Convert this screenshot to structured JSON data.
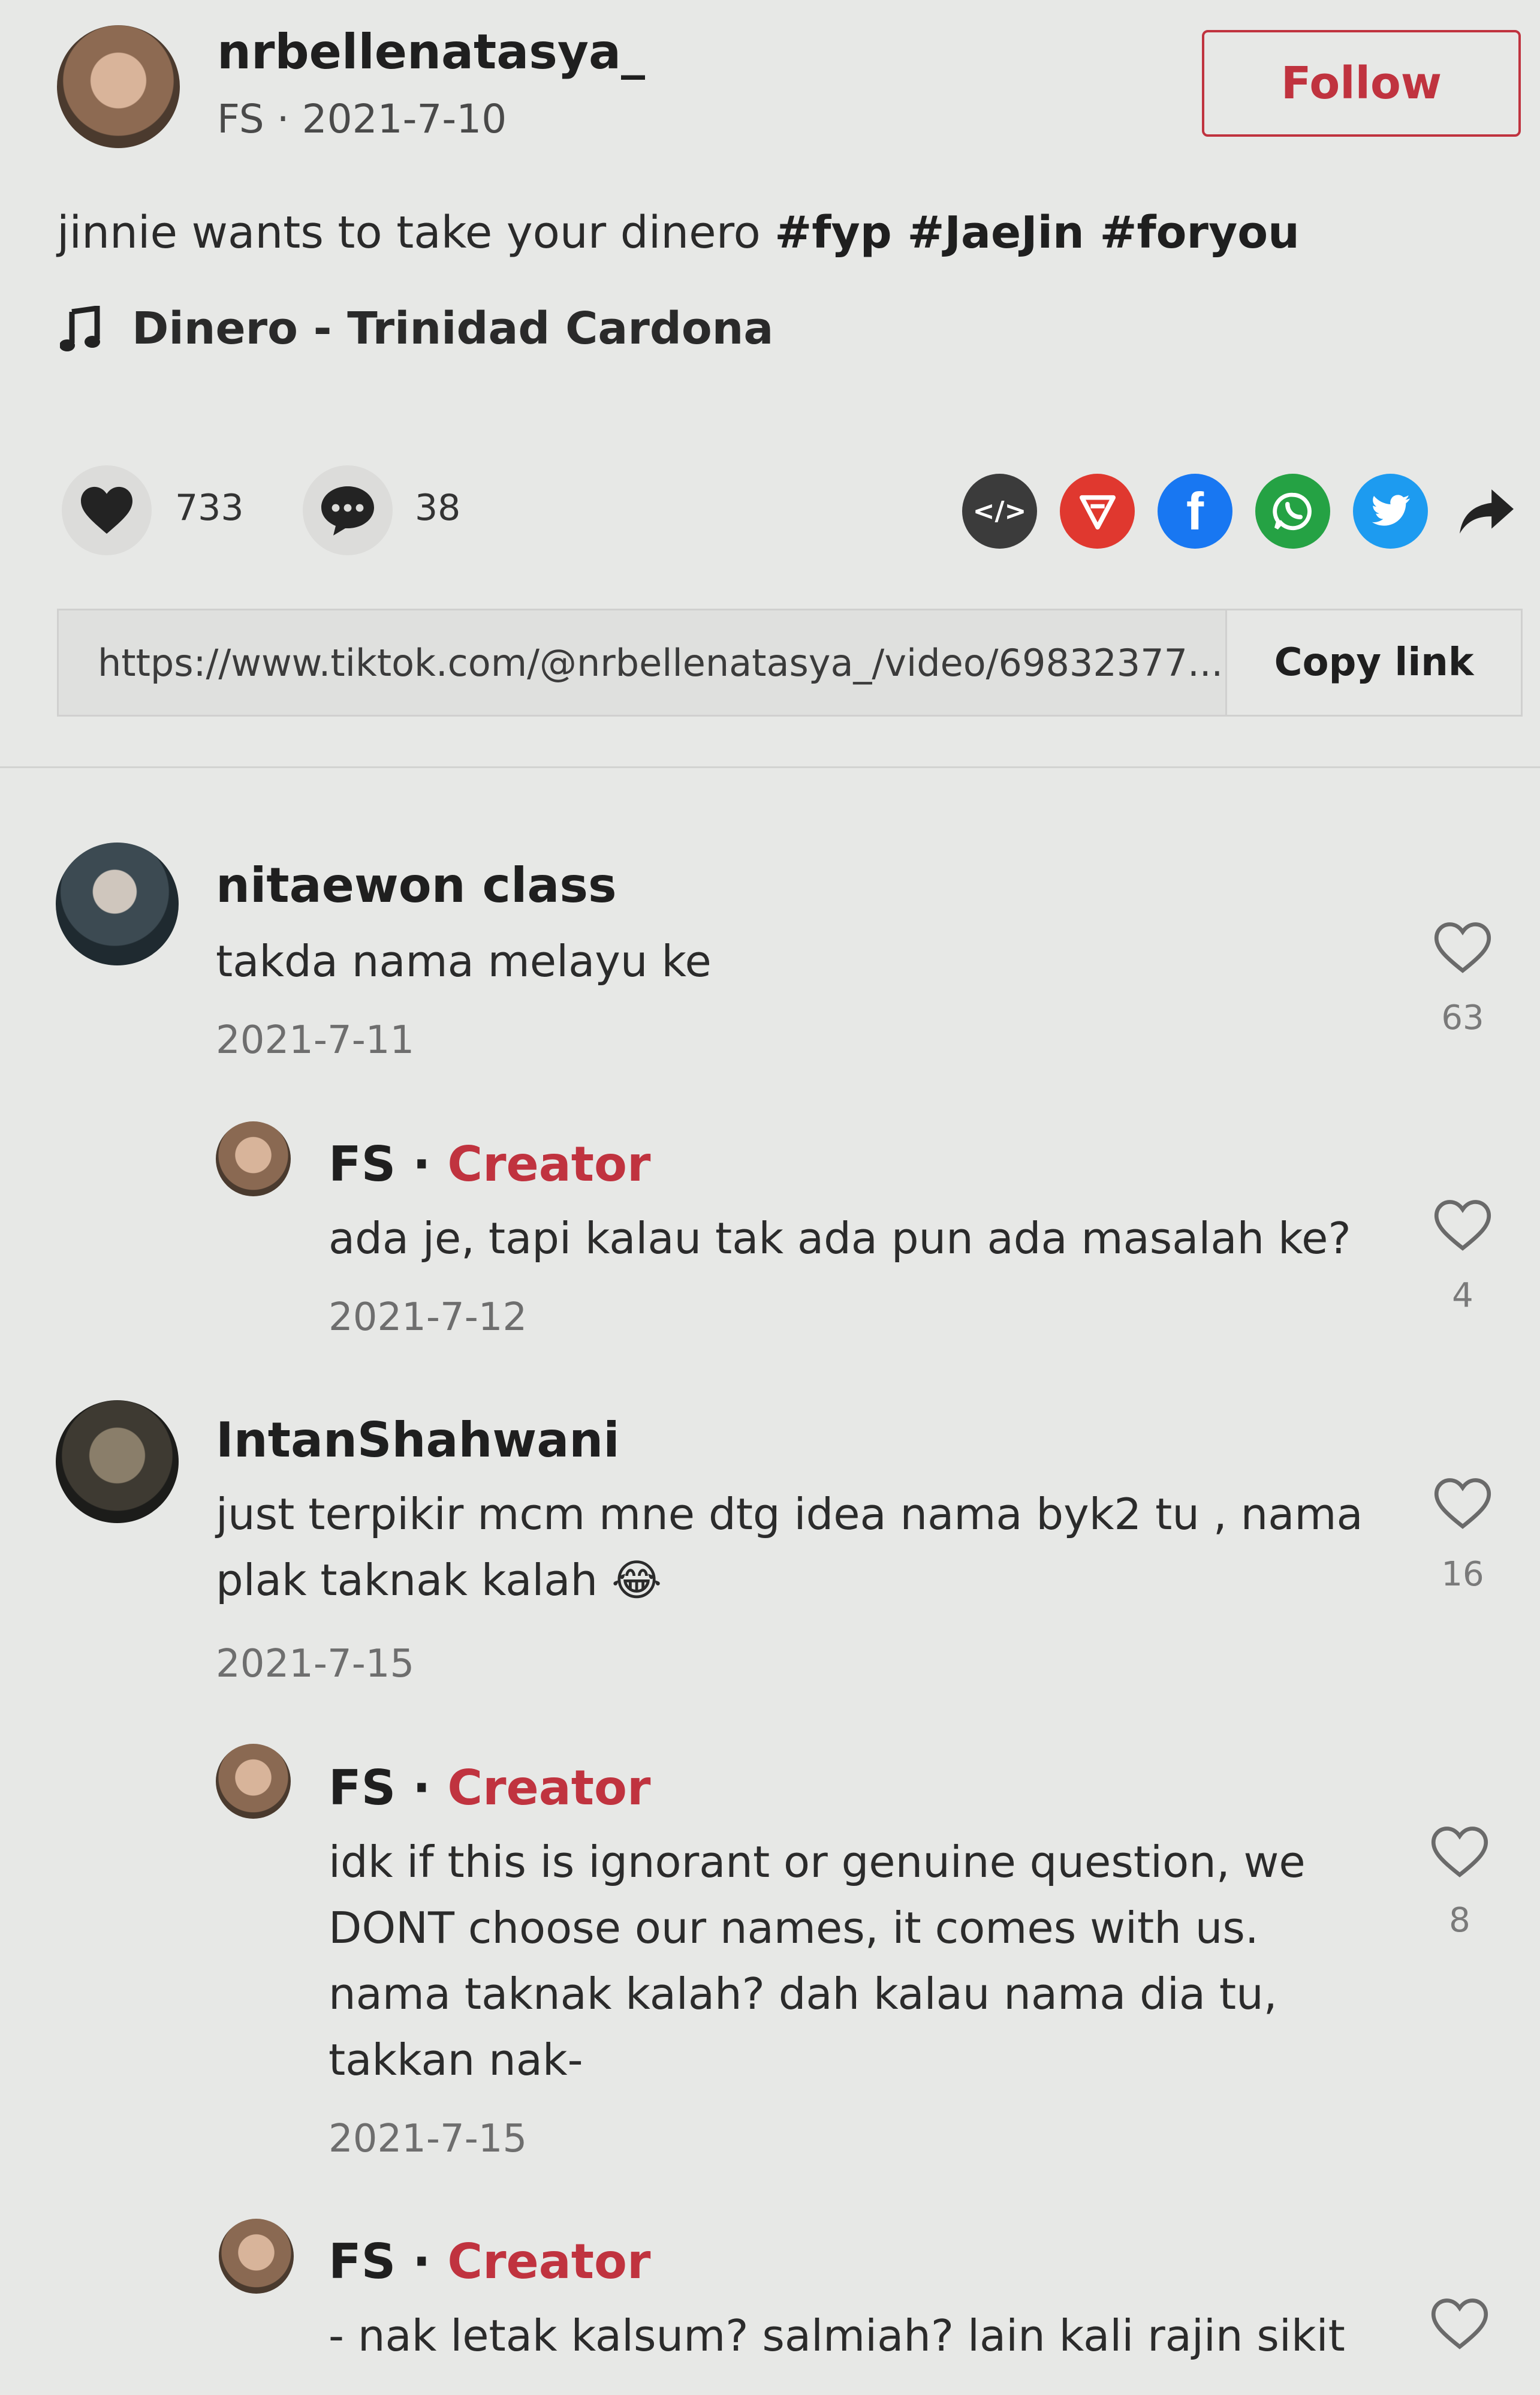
{
  "post": {
    "username": "nrbellenatasya_",
    "meta": "FS · 2021-7-10",
    "follow_label": "Follow",
    "caption_text": "jinnie wants to take your dinero ",
    "hashtags": "#fyp #JaeJin #foryou",
    "music": "Dinero - Trinidad Cardona",
    "likes": "733",
    "comments": "38",
    "share_icons": [
      "embed-icon",
      "send-icon",
      "facebook-icon",
      "whatsapp-icon",
      "twitter-icon",
      "share-arrow-icon"
    ],
    "link_url": "https://www.tiktok.com/@nrbellenatasya_/video/69832377...",
    "copy_label": "Copy link"
  },
  "colors": {
    "accent": "#c0333f",
    "facebook": "#1877f2",
    "whatsapp": "#25a244",
    "twitter": "#1d9bf0",
    "send": "#e0382f",
    "embed": "#3b3b3b"
  },
  "comments": [
    {
      "name": "nitaewon class",
      "text": "takda nama melayu ke",
      "date": "2021-7-11",
      "likes": "63"
    },
    {
      "name": "FS",
      "badge": "Creator",
      "sep": " · ",
      "text": "ada je, tapi kalau tak ada pun ada masalah ke?",
      "date": "2021-7-12",
      "likes": "4"
    },
    {
      "name": "IntanShahwani",
      "text_line1": "just terpikir mcm mne dtg idea nama byk2 tu , nama",
      "text_line2": "plak taknak kalah 😂",
      "date": "2021-7-15",
      "likes": "16"
    },
    {
      "name": "FS",
      "badge": "Creator",
      "sep": " · ",
      "lines": [
        "idk if this is ignorant or genuine question, we",
        "DONT choose our names, it comes with us.",
        "nama taknak kalah? dah kalau nama dia tu,",
        "takkan nak-"
      ],
      "date": "2021-7-15",
      "likes": "8"
    },
    {
      "name": "FS",
      "badge": "Creator",
      "sep": " · ",
      "text": "- nak letak kalsum? salmiah? lain kali rajin sikit"
    }
  ]
}
